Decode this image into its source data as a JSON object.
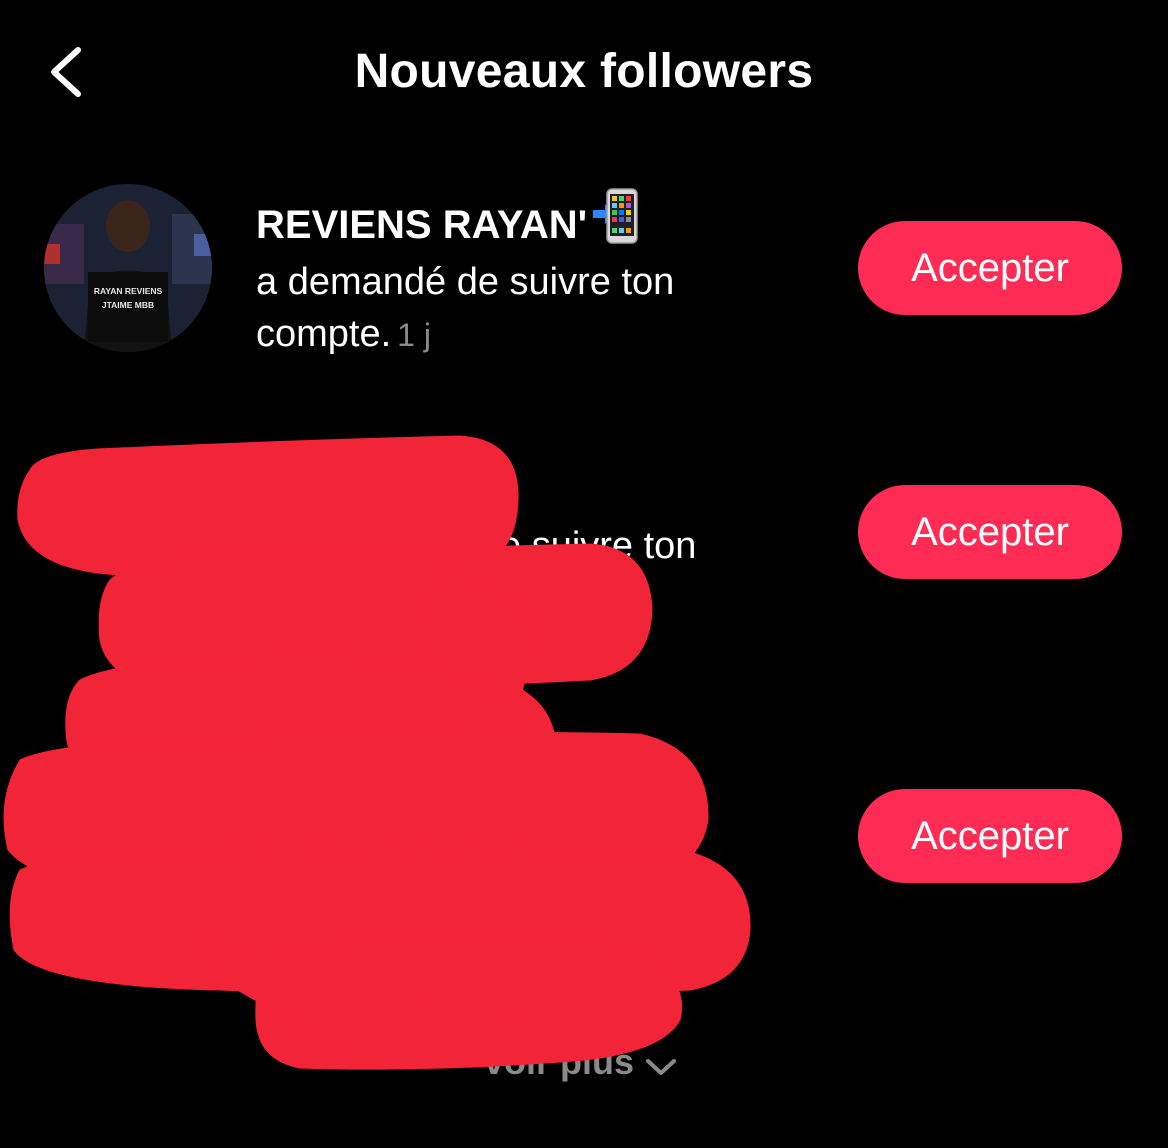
{
  "header": {
    "title": "Nouveaux followers",
    "back_icon": "chevron-left-icon"
  },
  "requests": [
    {
      "username": "REVIENS RAYAN'",
      "username_emoji": "📲",
      "text": "a demandé de suivre ton compte.",
      "time": "1 j",
      "avatar_shirt_text_line1": "RAYAN REVIENS",
      "avatar_shirt_text_line2": "JTAIME MBB",
      "button_label": "Accepter"
    },
    {
      "text_partial": "e suivre ton",
      "button_label": "Accepter"
    },
    {
      "button_label": "Accepter"
    }
  ],
  "footer": {
    "see_more_label": "voir plus",
    "see_more_icon": "chevron-down-icon"
  },
  "colors": {
    "background": "#000000",
    "accent": "#fe2c55",
    "muted_text": "#8a8a8a",
    "redaction": "#f22437"
  }
}
